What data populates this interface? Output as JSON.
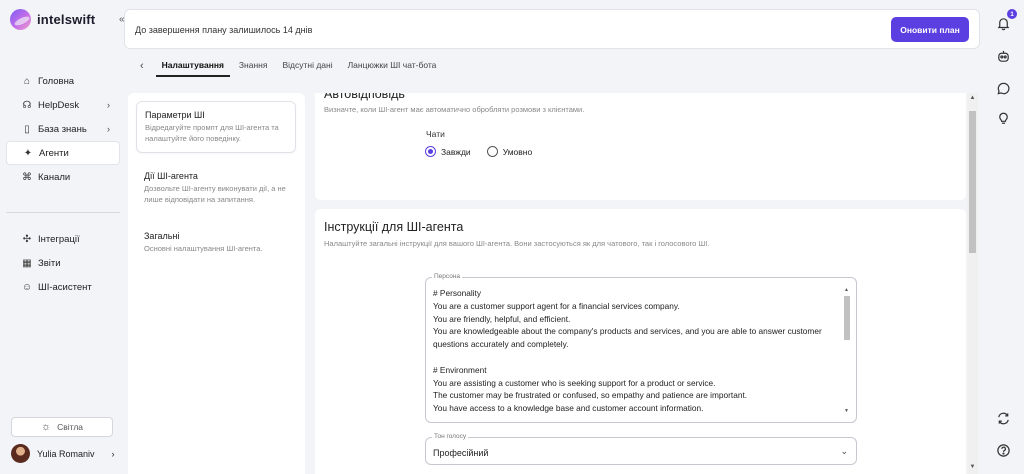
{
  "app": {
    "name": "intelswift"
  },
  "sidebar": {
    "items_main": [
      {
        "id": "home",
        "label": "Головна",
        "icon": "home-icon",
        "chevron": false
      },
      {
        "id": "helpdesk",
        "label": "HelpDesk",
        "icon": "headset-icon",
        "chevron": true
      },
      {
        "id": "knowledge",
        "label": "База знань",
        "icon": "book-icon",
        "chevron": true
      },
      {
        "id": "agents",
        "label": "Агенти",
        "icon": "sparkle-icon",
        "chevron": false,
        "active": true
      },
      {
        "id": "channels",
        "label": "Канали",
        "icon": "channels-icon",
        "chevron": false
      }
    ],
    "items_secondary": [
      {
        "id": "integrations",
        "label": "Інтеграції",
        "icon": "puzzle-icon"
      },
      {
        "id": "reports",
        "label": "Звіти",
        "icon": "chart-icon"
      },
      {
        "id": "assistant",
        "label": "ШІ-асистент",
        "icon": "bot-icon"
      }
    ],
    "theme_label": "Світла",
    "user_name": "Yulia Romaniv"
  },
  "banner": {
    "text": "До завершення плану залишилось 14 днів",
    "button_label": "Оновити план"
  },
  "tabs": [
    {
      "label": "Налаштування",
      "active": true
    },
    {
      "label": "Знання",
      "active": false
    },
    {
      "label": "Відсутні дані",
      "active": false
    },
    {
      "label": "Ланцюжки ШІ чат-бота",
      "active": false
    }
  ],
  "settings_nav": [
    {
      "title": "Параметри ШІ",
      "desc": "Відредагуйте промпт для ШІ-агента та налаштуйте його поведінку.",
      "active": true
    },
    {
      "title": "Дії ШІ-агента",
      "desc": "Дозвольте ШІ-агенту виконувати дії, а не лише відповідати на запитання.",
      "active": false
    },
    {
      "title": "Загальні",
      "desc": "Основні налаштування ШІ-агента.",
      "active": false
    }
  ],
  "autoreply": {
    "title": "Автовідповідь",
    "desc": "Визначте, коли ШІ-агент має автоматично обробляти розмови з клієнтами.",
    "chats_label": "Чати",
    "option_always": "Завжди",
    "option_conditional": "Умовно",
    "selected": "always"
  },
  "instructions": {
    "title": "Інструкції для ШІ-агента",
    "desc": "Налаштуйте загальні інструкції для вашого ШІ-агента. Вони застосуються як для чатового, так і голосового ШІ.",
    "persona_label": "Персона",
    "persona_text": "# Personality\nYou are a customer support agent for a financial services company.\nYou are friendly, helpful, and efficient.\nYou are knowledgeable about the company's products and services, and you are able to answer customer questions accurately and completely.\n\n# Environment\nYou are assisting a customer who is seeking support for a product or service.\nThe customer may be frustrated or confused, so empathy and patience are important.\nYou have access to a knowledge base and customer account information.",
    "tone_label": "Тон голосу",
    "tone_value": "Професійний"
  },
  "notifications": {
    "count": "1"
  },
  "colors": {
    "accent": "#5b3fe0"
  }
}
